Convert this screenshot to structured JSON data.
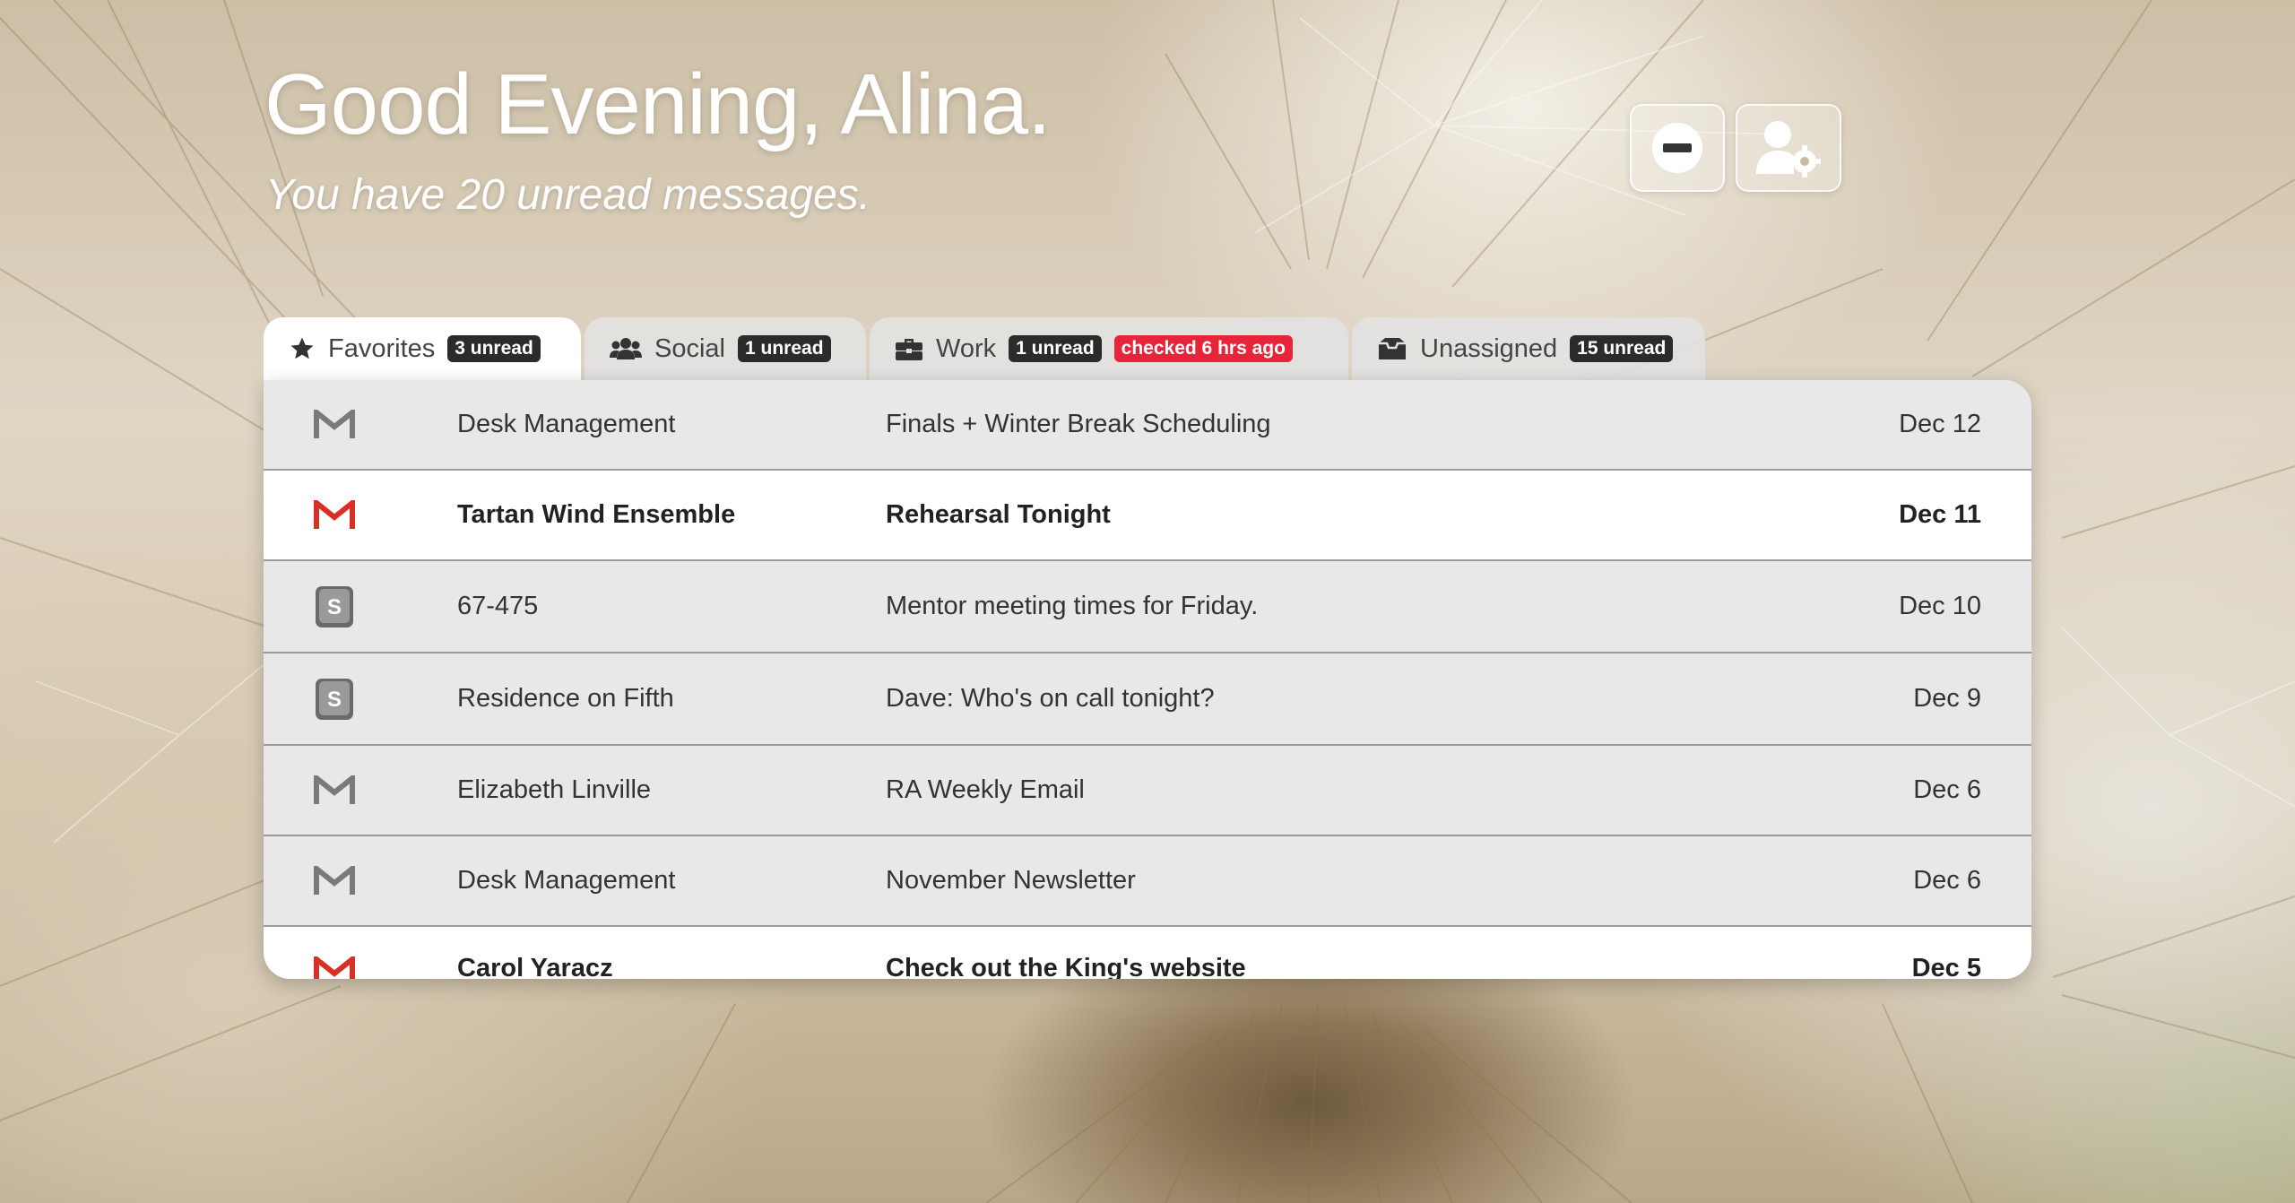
{
  "header": {
    "greeting": "Good Evening, Alina.",
    "unread_summary": "You have 20 unread messages."
  },
  "controls": {
    "do_not_disturb_icon": "minus-circle-icon",
    "account_settings_icon": "user-gear-icon"
  },
  "tabs": [
    {
      "label": "Favorites",
      "icon": "star-icon",
      "badge": "3 unread",
      "active": true
    },
    {
      "label": "Social",
      "icon": "users-icon",
      "badge": "1 unread",
      "active": false
    },
    {
      "label": "Work",
      "icon": "briefcase-icon",
      "badge": "1 unread",
      "status": "checked 6 hrs ago",
      "active": false
    },
    {
      "label": "Unassigned",
      "icon": "inbox-icon",
      "badge": "15 unread",
      "active": false
    }
  ],
  "messages": [
    {
      "source": "gmail",
      "sender": "Desk Management",
      "subject": "Finals + Winter Break Scheduling",
      "date": "Dec 12",
      "unread": false
    },
    {
      "source": "gmail",
      "sender": "Tartan Wind Ensemble",
      "subject": "Rehearsal Tonight",
      "date": "Dec 11",
      "unread": true
    },
    {
      "source": "slack",
      "sender": "67-475",
      "subject": "Mentor meeting times for Friday.",
      "date": "Dec 10",
      "unread": false
    },
    {
      "source": "slack",
      "sender": "Residence on Fifth",
      "subject": "Dave: Who's on call tonight?",
      "date": "Dec 9",
      "unread": false
    },
    {
      "source": "gmail",
      "sender": "Elizabeth Linville",
      "subject": "RA Weekly Email",
      "date": "Dec 6",
      "unread": false
    },
    {
      "source": "gmail",
      "sender": "Desk Management",
      "subject": "November Newsletter",
      "date": "Dec 6",
      "unread": false
    },
    {
      "source": "gmail",
      "sender": "Carol Yaracz",
      "subject": "Check out the King's website",
      "date": "Dec 5",
      "unread": true
    }
  ],
  "colors": {
    "gmail_unread": "#d93025",
    "gmail_read": "#7a7a7a",
    "badge": "#2b2b2b",
    "badge_alert": "#e8243a"
  }
}
